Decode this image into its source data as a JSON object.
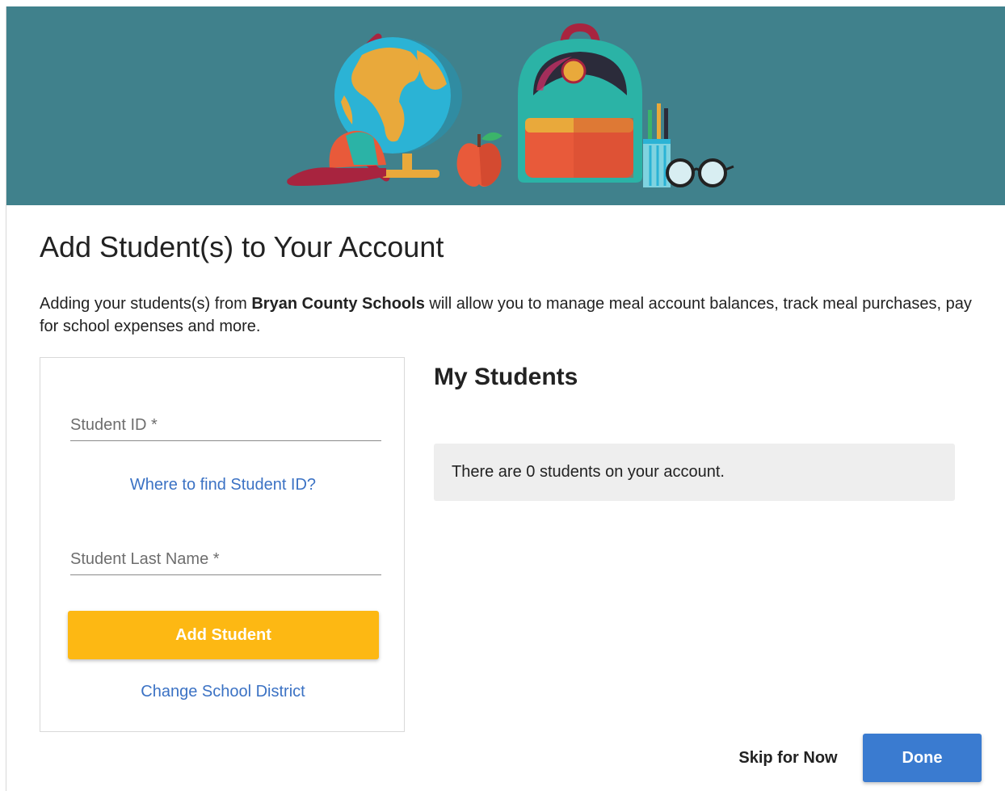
{
  "banner": {
    "background": "#40818c",
    "icons": [
      "cap-icon",
      "globe-icon",
      "apple-icon",
      "backpack-icon",
      "pencil-cup-icon",
      "glasses-icon"
    ]
  },
  "header": {
    "title": "Add Student(s) to Your Account"
  },
  "intro": {
    "prefix": "Adding your students(s) from ",
    "district": "Bryan County Schools",
    "suffix": " will allow you to manage meal account balances, track meal purchases, pay for school expenses and more."
  },
  "form": {
    "student_id_placeholder": "Student ID *",
    "student_id_value": "",
    "help_link": "Where to find Student ID?",
    "last_name_placeholder": "Student Last Name *",
    "last_name_value": "",
    "add_button": "Add Student",
    "change_district_link": "Change School District"
  },
  "students": {
    "title": "My Students",
    "empty_message": "There are 0 students on your account."
  },
  "footer": {
    "skip_label": "Skip for Now",
    "done_label": "Done"
  },
  "colors": {
    "banner": "#40818c",
    "add_button": "#fdb813",
    "done_button": "#3a7bd0",
    "link": "#3b72c4"
  }
}
